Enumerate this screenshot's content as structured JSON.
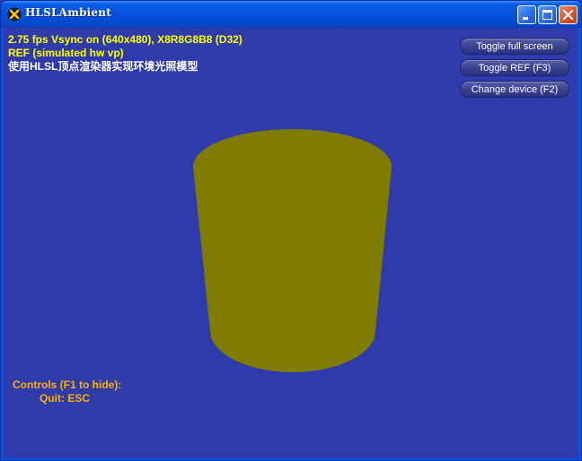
{
  "window": {
    "title": "HLSLAmbient",
    "icon": "directx-icon",
    "controls": [
      "minimize-icon",
      "maximize-icon",
      "close-icon"
    ]
  },
  "stats": {
    "line1": "2.75 fps Vsync on (640x480), X8R8G8B8 (D32)",
    "line2": "REF (simulated hw vp)",
    "line3": "使用HLSL顶点渲染器实现环境光照模型"
  },
  "buttons": {
    "toggle_full_screen": "Toggle full screen",
    "toggle_ref": "Toggle REF (F3)",
    "change_device": "Change device (F2)"
  },
  "controls_help": {
    "heading": "Controls (F1 to hide):",
    "quit": "Quit: ESC"
  },
  "colors": {
    "background": "#2f3aab",
    "cylinder": "#807c00",
    "stats_text": "#ffff00",
    "controls_text": "#ffb000"
  }
}
